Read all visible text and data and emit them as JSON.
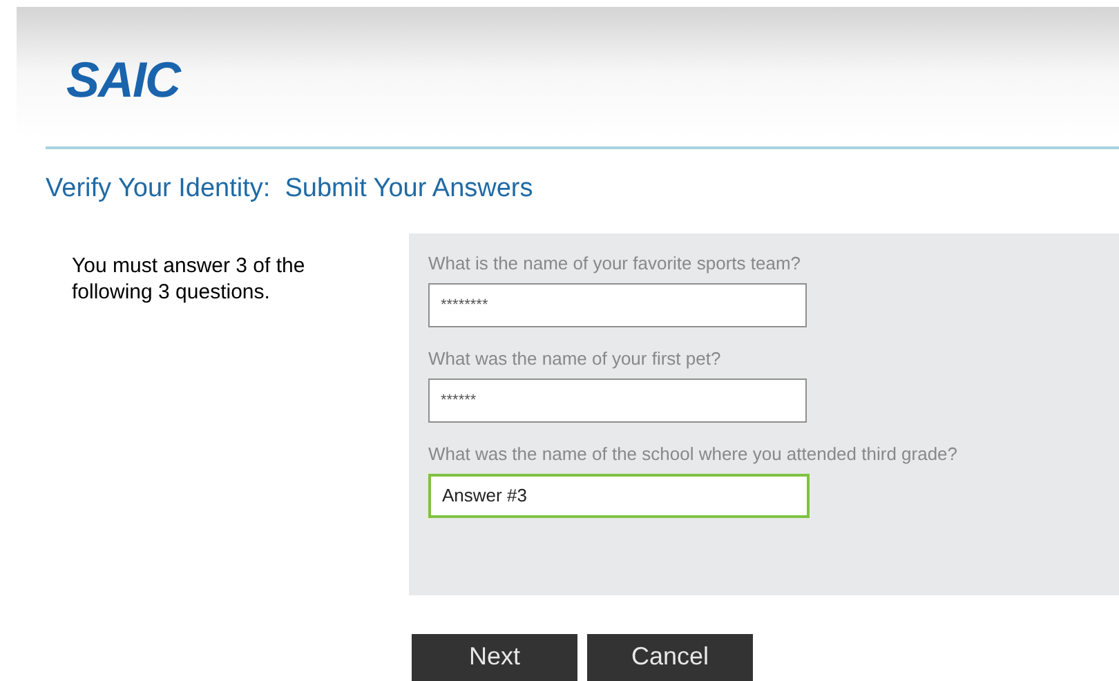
{
  "logo": "SAIC",
  "title": "Verify Your Identity:  Submit Your Answers",
  "instructions": "You must answer 3 of the following 3 questions.",
  "questions": [
    {
      "label": "What is the name of your favorite sports team?",
      "value": "********",
      "focused": false
    },
    {
      "label": "What was the name of your first pet?",
      "value": "******",
      "focused": false
    },
    {
      "label": "What was the name of the school where you attended third grade?",
      "value": "Answer #3",
      "focused": true
    }
  ],
  "buttons": [
    "Next",
    "Cancel"
  ]
}
